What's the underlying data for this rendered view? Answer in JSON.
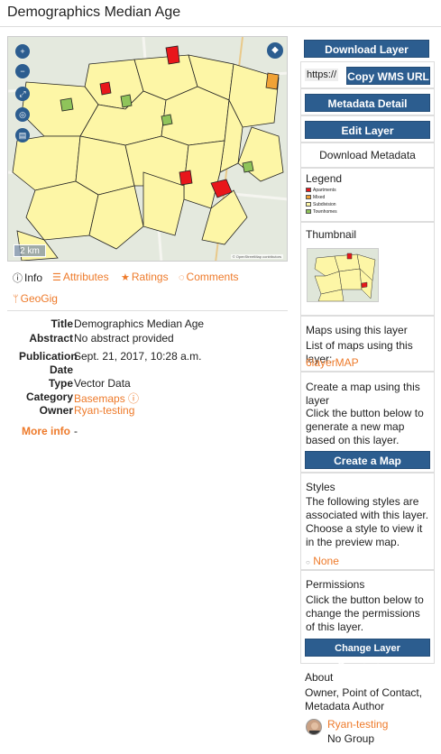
{
  "page": {
    "title": "Demographics Median Age"
  },
  "map": {
    "scale_label": "2 km",
    "attribution": "© OpenStreetMap contributors",
    "controls": [
      "zoom-in-icon",
      "zoom-out-icon",
      "fullscreen-icon",
      "locate-icon",
      "print-icon"
    ]
  },
  "tabs": [
    {
      "label": "Info",
      "icon": "info-icon"
    },
    {
      "label": "Attributes",
      "icon": "list-icon"
    },
    {
      "label": "Ratings",
      "icon": "star-icon"
    },
    {
      "label": "Comments",
      "icon": "comment-icon"
    },
    {
      "label": "GeoGig",
      "icon": "branch-icon"
    }
  ],
  "info": {
    "title_label": "Title",
    "title_value": "Demographics Median Age",
    "abstract_label": "Abstract",
    "abstract_value": "No abstract provided",
    "pubdate_label": "Publication Date",
    "pubdate_value": "Sept. 21, 2017, 10:28 a.m.",
    "type_label": "Type",
    "type_value": "Vector Data",
    "category_label": "Category",
    "category_value": "Basemaps",
    "owner_label": "Owner",
    "owner_value": "Ryan-testing",
    "more_info_label": "More info",
    "more_info_value": "-"
  },
  "sidebar": {
    "download_layer": "Download Layer",
    "wms_prefix": "https://",
    "copy_wms": "Copy WMS URL",
    "metadata_detail": "Metadata Detail",
    "edit_layer": "Edit Layer",
    "download_metadata": "Download Metadata",
    "legend_title": "Legend",
    "legend_items": [
      {
        "label": "Apartments",
        "color": "#e8161b"
      },
      {
        "label": "Mixed",
        "color": "#f0a236"
      },
      {
        "label": "Subdivision",
        "color": "#fdf6a6"
      },
      {
        "label": "Townhomes",
        "color": "#8fc45a"
      }
    ],
    "thumbnail_title": "Thumbnail",
    "maps_title": "Maps using this layer",
    "maps_list_label": "List of maps using this layer:",
    "maps_link": "6layerMAP",
    "create_title": "Create a map using this layer",
    "create_text": "Click the button below to generate a new map based on this layer.",
    "create_button": "Create a Map",
    "styles_title": "Styles",
    "styles_text": "The following styles are associated with this layer. Choose a style to view it in the preview map.",
    "styles_option": "None",
    "permissions_title": "Permissions",
    "permissions_text": "Click the button below to change the permissions of this layer.",
    "permissions_button": "Change Layer Permissions",
    "about_title": "About",
    "about_text": "Owner, Point of Contact, Metadata Author",
    "about_user": "Ryan-testing",
    "about_group": "No Group"
  },
  "colors": {
    "accent": "#ee7a2a",
    "button": "#2c5d8f",
    "fill": "#fdf6a6"
  }
}
